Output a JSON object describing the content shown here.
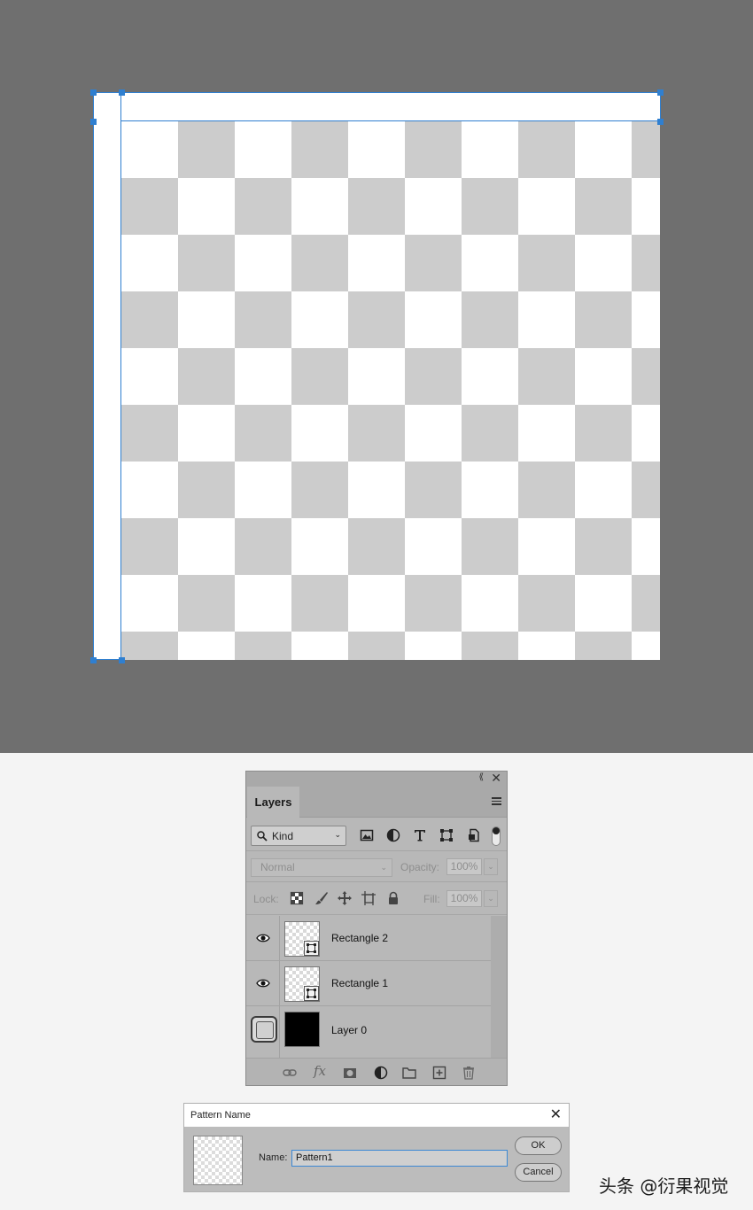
{
  "layers_panel": {
    "tab_label": "Layers",
    "filter": {
      "kind_label": "Kind"
    },
    "blend_mode": "Normal",
    "opacity_label": "Opacity:",
    "opacity_value": "100%",
    "lock_label": "Lock:",
    "fill_label": "Fill:",
    "fill_value": "100%",
    "layers": [
      {
        "name": "Rectangle 2",
        "visible": true,
        "type": "shape"
      },
      {
        "name": "Rectangle 1",
        "visible": true,
        "type": "shape"
      },
      {
        "name": "Layer 0",
        "visible": false,
        "type": "fill-black"
      }
    ]
  },
  "pattern_dialog": {
    "title": "Pattern Name",
    "name_label": "Name:",
    "name_value": "Pattern1",
    "ok_label": "OK",
    "cancel_label": "Cancel"
  },
  "watermark": "头条 @衍果视觉",
  "colors": {
    "canvas_background": "#6f6f6f",
    "checker_gray": "#cccccc",
    "selection_blue": "#2f7fd0",
    "panel_gray": "#b8b8b8"
  }
}
